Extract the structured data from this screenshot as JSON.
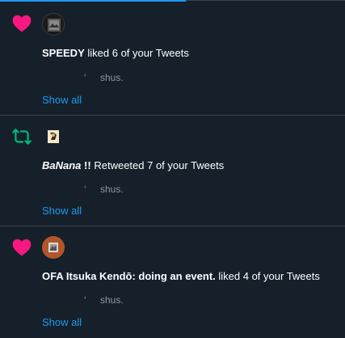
{
  "colors": {
    "background": "#15202b",
    "divider": "#38444d",
    "like": "#f91880",
    "retweet": "#00ba7c",
    "link": "#1d9bf0",
    "muted": "#8b98a5"
  },
  "notifications": [
    {
      "type_icon": "heart-icon",
      "user_name": "SPEEDY",
      "action_text": "liked 6 of your Tweets",
      "quote_mark": "‘",
      "quote_text": "shus.",
      "show_all_label": "Show all"
    },
    {
      "type_icon": "retweet-icon",
      "user_name": "BaNana",
      "user_name_suffix": "!!",
      "action_text": "Retweeted 7 of your Tweets",
      "quote_mark": "‘",
      "quote_text": "shus.",
      "show_all_label": "Show all"
    },
    {
      "type_icon": "heart-icon",
      "user_name": "OFA Itsuka Kendō: doing an event.",
      "action_text": "liked 4 of your Tweets",
      "quote_mark": "‘",
      "quote_text": "shus.",
      "show_all_label": "Show all"
    }
  ]
}
